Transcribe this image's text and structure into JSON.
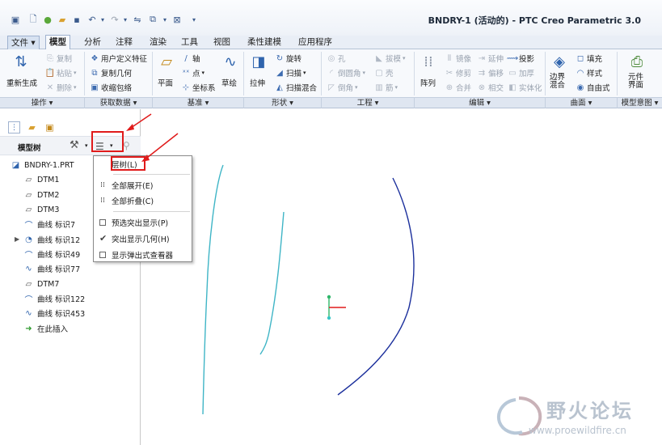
{
  "window": {
    "title": "BNDRY-1 (活动的) - PTC Creo Parametric 3.0"
  },
  "quick_access": [
    {
      "icon": "app-menu-icon"
    },
    {
      "icon": "new-file-icon"
    },
    {
      "icon": "open-icon"
    },
    {
      "icon": "folder-icon"
    },
    {
      "icon": "save-icon"
    },
    {
      "icon": "undo-icon"
    },
    {
      "icon": "redo-icon"
    },
    {
      "icon": "regenerate-icon"
    },
    {
      "icon": "windows-icon"
    },
    {
      "icon": "close-window-icon"
    },
    {
      "icon": "customize-icon"
    }
  ],
  "tabs": [
    {
      "label": "文件 ▾"
    },
    {
      "label": "模型"
    },
    {
      "label": "分析"
    },
    {
      "label": "注释"
    },
    {
      "label": "渲染"
    },
    {
      "label": "工具"
    },
    {
      "label": "视图"
    },
    {
      "label": "柔性建模"
    },
    {
      "label": "应用程序"
    }
  ],
  "ribbon": {
    "operations": {
      "regenerate": "重新生成",
      "copy": "复制",
      "paste": "粘贴",
      "delete": "删除"
    },
    "get_data": {
      "udf": "用户定义特征",
      "copy_geom": "复制几何",
      "shrinkwrap": "收缩包络"
    },
    "datum": {
      "plane": "平面",
      "axis": "轴",
      "point": "点",
      "csys": "坐标系",
      "sketch": "草绘"
    },
    "shapes": {
      "extrude": "拉伸",
      "revolve": "旋转",
      "sweep": "扫描",
      "swept_blend": "扫描混合"
    },
    "engineering": {
      "hole": "孔",
      "draft": "拔模",
      "round": "倒圆角",
      "shell": "壳",
      "chamfer": "倒角",
      "rib": "筋"
    },
    "editing": {
      "pattern": "阵列",
      "mirror": "镜像",
      "extend": "延伸",
      "project": "投影",
      "trim": "修剪",
      "offset": "偏移",
      "thicken": "加厚",
      "merge": "合并",
      "intersect": "相交",
      "solidify": "实体化"
    },
    "surfaces": {
      "boundary_blend": "边界\n混合",
      "fill": "填充",
      "style": "样式",
      "freestyle": "自由式"
    },
    "model_intent": {
      "component_interface": "元件\n界面"
    }
  },
  "groups": [
    {
      "label": "操作 ▾"
    },
    {
      "label": "获取数据 ▾"
    },
    {
      "label": "基准 ▾"
    },
    {
      "label": "形状 ▾"
    },
    {
      "label": "工程 ▾"
    },
    {
      "label": "编辑 ▾"
    },
    {
      "label": "曲面 ▾"
    },
    {
      "label": "模型意图 ▾"
    }
  ],
  "panel": {
    "title": "模型树",
    "tree": [
      {
        "label": "BNDRY-1.PRT",
        "icon": "part-icon"
      },
      {
        "label": "DTM1",
        "icon": "datum-plane-icon"
      },
      {
        "label": "DTM2",
        "icon": "datum-plane-icon"
      },
      {
        "label": "DTM3",
        "icon": "datum-plane-icon"
      },
      {
        "label": "曲线 标识7",
        "icon": "curve-icon"
      },
      {
        "label": "曲线 标识12",
        "icon": "curve-feature-icon"
      },
      {
        "label": "曲线 标识49",
        "icon": "curve-icon"
      },
      {
        "label": "曲线 标识77",
        "icon": "curve-icon"
      },
      {
        "label": "DTM7",
        "icon": "datum-plane-icon"
      },
      {
        "label": "曲线 标识122",
        "icon": "curve-icon"
      },
      {
        "label": "曲线 标识453",
        "icon": "curve-icon"
      },
      {
        "label": "在此插入",
        "icon": "insert-here-icon"
      }
    ]
  },
  "menu": {
    "items": [
      {
        "label": "层树(L)"
      },
      {
        "label": "全部展开(E)"
      },
      {
        "label": "全部折叠(C)"
      },
      {
        "label": "预选突出显示(P)",
        "checked": false
      },
      {
        "label": "突出显示几何(H)",
        "checked": true
      },
      {
        "label": "显示弹出式查看器",
        "checked": false
      }
    ]
  },
  "watermark": {
    "title": "野火论坛",
    "url": "www.proewildfire.cn"
  },
  "colors": {
    "annotation_red": "#e01b1b",
    "curve_cyan": "#3fb5c6",
    "curve_navy": "#1b2f9c"
  }
}
